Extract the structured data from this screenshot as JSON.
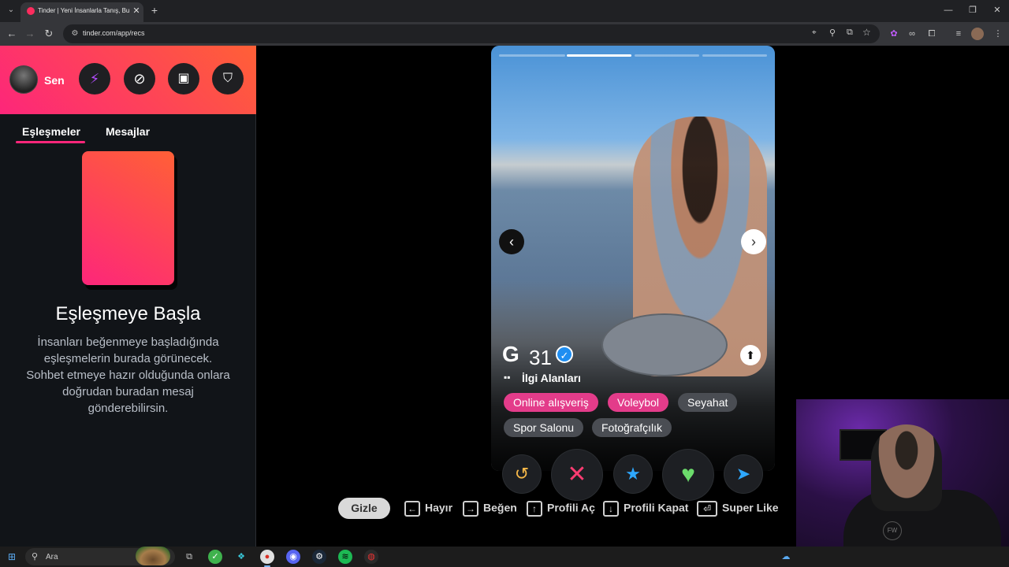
{
  "browser": {
    "tab_title": "Tinder | Yeni İnsanlarla Tanış, Bu",
    "url": "tinder.com/app/recs",
    "close_glyph": "✕",
    "new_tab_glyph": "+",
    "tab_list_glyph": "⌄",
    "window_min": "—",
    "window_max": "❐",
    "window_close": "✕",
    "back_glyph": "←",
    "forward_glyph": "→",
    "reload_glyph": "↻",
    "site_info_glyph": "⚙"
  },
  "sidebar": {
    "user_name": "Sen",
    "tabs": [
      "Eşleşmeler",
      "Mesajlar"
    ],
    "empty_title": "Eşleşmeye Başla",
    "empty_text": "İnsanları beğenmeye başladığında eşleşmelerin burada görünecek. Sohbet etmeye hazır olduğunda onlara doğrudan buradan mesaj gönderebilirsin."
  },
  "profile": {
    "name": "G",
    "age": "31",
    "interests_label": "İlgi Alanları",
    "interests": [
      {
        "label": "Online alışveriş",
        "shared": true
      },
      {
        "label": "Voleybol",
        "shared": true
      },
      {
        "label": "Seyahat",
        "shared": false
      },
      {
        "label": "Spor Salonu",
        "shared": false
      },
      {
        "label": "Fotoğrafçılık",
        "shared": false
      }
    ],
    "photo_count": 4,
    "active_photo": 2
  },
  "keyboard_hints": {
    "hide_label": "Gizle",
    "items": [
      {
        "key": "←",
        "label": "Hayır"
      },
      {
        "key": "→",
        "label": "Beğen"
      },
      {
        "key": "↑",
        "label": "Profili Aç"
      },
      {
        "key": "↓",
        "label": "Profili Kapat"
      },
      {
        "key": "⏎",
        "label": "Super Like"
      }
    ]
  },
  "taskbar": {
    "search_placeholder": "Ara"
  },
  "colors": {
    "brand_gradient_start": "#fd267a",
    "brand_gradient_end": "#ff6036",
    "shared_interest": "#e33c8a",
    "rewind": "#f5b748",
    "nope": "#fe3c72",
    "superlike": "#2ea8ff",
    "like": "#6bdb6b",
    "boost": "#2ea8ff"
  }
}
